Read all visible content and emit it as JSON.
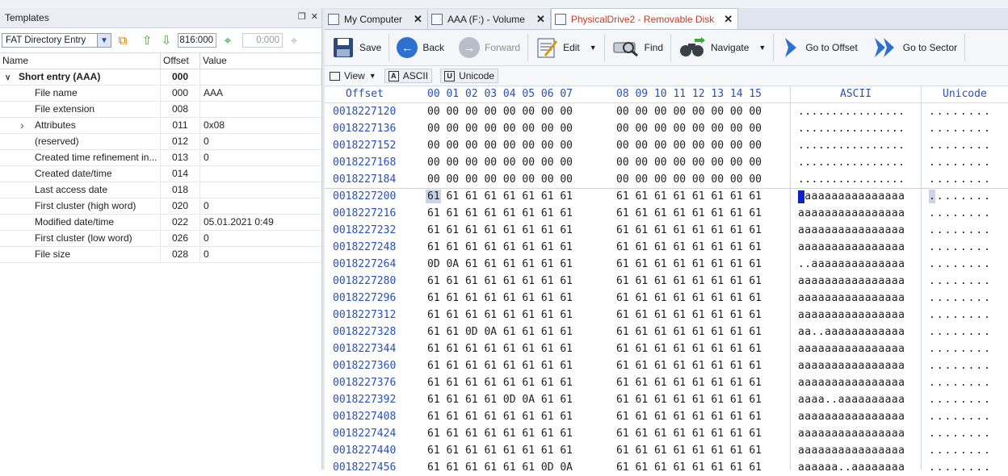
{
  "templates_panel": {
    "title": "Templates",
    "template_select": "FAT Directory Entry",
    "offset_input": "816:000",
    "disabled_input": "0:000",
    "columns": [
      "Name",
      "Offset",
      "Value"
    ],
    "group": {
      "name": "Short entry (AAA)",
      "offset": "000",
      "value": ""
    },
    "rows": [
      {
        "name": "File name",
        "offset": "000",
        "value": "AAA"
      },
      {
        "name": "File extension",
        "offset": "008",
        "value": ""
      },
      {
        "name": "Attributes",
        "offset": "011",
        "value": "0x08",
        "expandable": true
      },
      {
        "name": "(reserved)",
        "offset": "012",
        "value": "0"
      },
      {
        "name": "Created time refinement in...",
        "offset": "013",
        "value": "0"
      },
      {
        "name": "Created date/time",
        "offset": "014",
        "value": ""
      },
      {
        "name": "Last access date",
        "offset": "018",
        "value": ""
      },
      {
        "name": "First cluster (high word)",
        "offset": "020",
        "value": "0"
      },
      {
        "name": "Modified date/time",
        "offset": "022",
        "value": "05.01.2021 0:49"
      },
      {
        "name": "First cluster (low word)",
        "offset": "026",
        "value": "0"
      },
      {
        "name": "File size",
        "offset": "028",
        "value": "0"
      }
    ]
  },
  "tabs": [
    {
      "label": "My Computer",
      "active": false
    },
    {
      "label": "AAA (F:) - Volume",
      "active": false
    },
    {
      "label": "PhysicalDrive2 - Removable Disk",
      "active": true
    }
  ],
  "toolbar": {
    "save": "Save",
    "back": "Back",
    "forward": "Forward",
    "edit": "Edit",
    "find": "Find",
    "navigate": "Navigate",
    "goto_offset": "Go to Offset",
    "goto_sector": "Go to Sector"
  },
  "viewbar": {
    "view": "View",
    "ascii": "ASCII",
    "unicode": "Unicode"
  },
  "hex_header": {
    "offset": "Offset",
    "cols1": "00 01 02 03 04 05 06 07",
    "cols2": "08 09 10 11 12 13 14 15",
    "ascii": "ASCII",
    "unicode": "Unicode"
  },
  "hex_rows": [
    {
      "offset": "0018227120",
      "h1": "00 00 00 00 00 00 00 00",
      "h2": "00 00 00 00 00 00 00 00",
      "ascii": "................",
      "unicode": "........"
    },
    {
      "offset": "0018227136",
      "h1": "00 00 00 00 00 00 00 00",
      "h2": "00 00 00 00 00 00 00 00",
      "ascii": "................",
      "unicode": "........"
    },
    {
      "offset": "0018227152",
      "h1": "00 00 00 00 00 00 00 00",
      "h2": "00 00 00 00 00 00 00 00",
      "ascii": "................",
      "unicode": "........"
    },
    {
      "offset": "0018227168",
      "h1": "00 00 00 00 00 00 00 00",
      "h2": "00 00 00 00 00 00 00 00",
      "ascii": "................",
      "unicode": "........"
    },
    {
      "offset": "0018227184",
      "h1": "00 00 00 00 00 00 00 00",
      "h2": "00 00 00 00 00 00 00 00",
      "ascii": "................",
      "unicode": "........"
    },
    {
      "offset": "0018227200",
      "h1": "61 61 61 61 61 61 61 61",
      "h2": "61 61 61 61 61 61 61 61",
      "ascii": " aaaaaaaaaaaaaaa",
      "unicode": "........",
      "cursor": true
    },
    {
      "offset": "0018227216",
      "h1": "61 61 61 61 61 61 61 61",
      "h2": "61 61 61 61 61 61 61 61",
      "ascii": "aaaaaaaaaaaaaaaa",
      "unicode": "........"
    },
    {
      "offset": "0018227232",
      "h1": "61 61 61 61 61 61 61 61",
      "h2": "61 61 61 61 61 61 61 61",
      "ascii": "aaaaaaaaaaaaaaaa",
      "unicode": "........"
    },
    {
      "offset": "0018227248",
      "h1": "61 61 61 61 61 61 61 61",
      "h2": "61 61 61 61 61 61 61 61",
      "ascii": "aaaaaaaaaaaaaaaa",
      "unicode": "........"
    },
    {
      "offset": "0018227264",
      "h1": "0D 0A 61 61 61 61 61 61",
      "h2": "61 61 61 61 61 61 61 61",
      "ascii": "..aaaaaaaaaaaaaa",
      "unicode": "........"
    },
    {
      "offset": "0018227280",
      "h1": "61 61 61 61 61 61 61 61",
      "h2": "61 61 61 61 61 61 61 61",
      "ascii": "aaaaaaaaaaaaaaaa",
      "unicode": "........"
    },
    {
      "offset": "0018227296",
      "h1": "61 61 61 61 61 61 61 61",
      "h2": "61 61 61 61 61 61 61 61",
      "ascii": "aaaaaaaaaaaaaaaa",
      "unicode": "........"
    },
    {
      "offset": "0018227312",
      "h1": "61 61 61 61 61 61 61 61",
      "h2": "61 61 61 61 61 61 61 61",
      "ascii": "aaaaaaaaaaaaaaaa",
      "unicode": "........"
    },
    {
      "offset": "0018227328",
      "h1": "61 61 0D 0A 61 61 61 61",
      "h2": "61 61 61 61 61 61 61 61",
      "ascii": "aa..aaaaaaaaaaaa",
      "unicode": "........"
    },
    {
      "offset": "0018227344",
      "h1": "61 61 61 61 61 61 61 61",
      "h2": "61 61 61 61 61 61 61 61",
      "ascii": "aaaaaaaaaaaaaaaa",
      "unicode": "........"
    },
    {
      "offset": "0018227360",
      "h1": "61 61 61 61 61 61 61 61",
      "h2": "61 61 61 61 61 61 61 61",
      "ascii": "aaaaaaaaaaaaaaaa",
      "unicode": "........"
    },
    {
      "offset": "0018227376",
      "h1": "61 61 61 61 61 61 61 61",
      "h2": "61 61 61 61 61 61 61 61",
      "ascii": "aaaaaaaaaaaaaaaa",
      "unicode": "........"
    },
    {
      "offset": "0018227392",
      "h1": "61 61 61 61 0D 0A 61 61",
      "h2": "61 61 61 61 61 61 61 61",
      "ascii": "aaaa..aaaaaaaaaa",
      "unicode": "........"
    },
    {
      "offset": "0018227408",
      "h1": "61 61 61 61 61 61 61 61",
      "h2": "61 61 61 61 61 61 61 61",
      "ascii": "aaaaaaaaaaaaaaaa",
      "unicode": "........"
    },
    {
      "offset": "0018227424",
      "h1": "61 61 61 61 61 61 61 61",
      "h2": "61 61 61 61 61 61 61 61",
      "ascii": "aaaaaaaaaaaaaaaa",
      "unicode": "........"
    },
    {
      "offset": "0018227440",
      "h1": "61 61 61 61 61 61 61 61",
      "h2": "61 61 61 61 61 61 61 61",
      "ascii": "aaaaaaaaaaaaaaaa",
      "unicode": "........"
    },
    {
      "offset": "0018227456",
      "h1": "61 61 61 61 61 61 0D 0A",
      "h2": "61 61 61 61 61 61 61 61",
      "ascii": "aaaaaa..aaaaaaaa",
      "unicode": "........"
    }
  ]
}
